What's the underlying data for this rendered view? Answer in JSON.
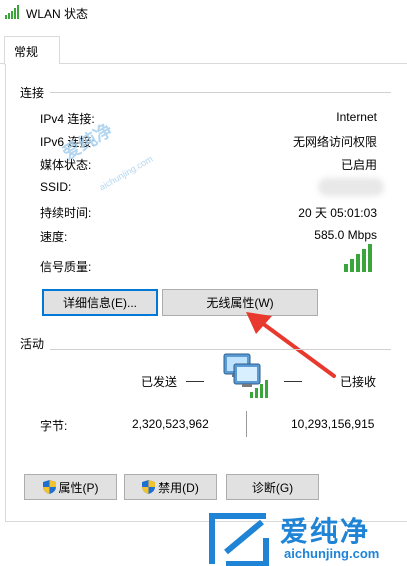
{
  "window": {
    "title": "WLAN 状态"
  },
  "tabs": [
    {
      "label": "常规"
    }
  ],
  "connection": {
    "section_title": "连接",
    "rows": [
      {
        "label": "IPv4 连接:",
        "value": "Internet"
      },
      {
        "label": "IPv6 连接:",
        "value": "无网络访问权限"
      },
      {
        "label": "媒体状态:",
        "value": "已启用"
      },
      {
        "label": "SSID:",
        "value": ""
      },
      {
        "label": "持续时间:",
        "value": "20 天 05:01:03"
      },
      {
        "label": "速度:",
        "value": "585.0 Mbps"
      },
      {
        "label": "信号质量:",
        "value": ""
      }
    ],
    "signal_bars_filled": 5,
    "signal_bars_total": 5,
    "buttons": {
      "details": "详细信息(E)...",
      "wireless_properties": "无线属性(W)"
    }
  },
  "activity": {
    "section_title": "活动",
    "sent_label": "已发送",
    "received_label": "已接收",
    "bytes_label": "字节:",
    "bytes_sent": "2,320,523,962",
    "bytes_received": "10,293,156,915"
  },
  "bottom_buttons": {
    "properties": "属性(P)",
    "disable": "禁用(D)",
    "diagnose": "诊断(G)"
  },
  "watermark": {
    "text": "爱纯净",
    "url": "aichunjing.com"
  },
  "colors": {
    "arrow": "#e8392f",
    "signal": "#3aa53a",
    "focus": "#0078d7",
    "watermark": "#1f83d6"
  }
}
